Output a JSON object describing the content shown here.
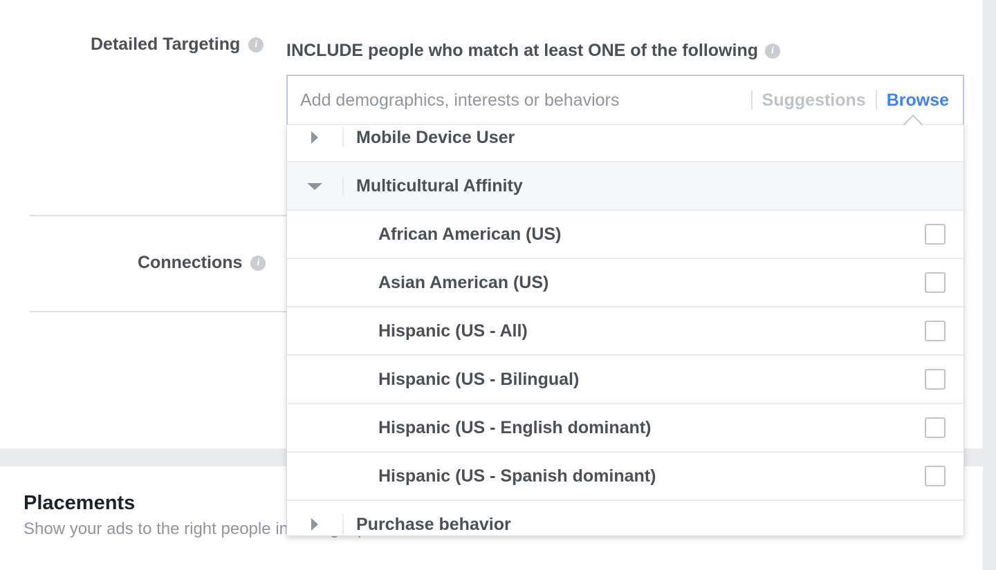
{
  "targeting": {
    "label": "Detailed Targeting",
    "include_text": "INCLUDE people who match at least ONE of the following",
    "search": {
      "placeholder": "Add demographics, interests or behaviors",
      "tabs": {
        "suggestions": "Suggestions",
        "browse": "Browse"
      },
      "active_tab": "Browse"
    }
  },
  "connections": {
    "label": "Connections"
  },
  "placements": {
    "title": "Placements",
    "subtitle": "Show your ads to the right people in the right places."
  },
  "browse_list": {
    "categories": [
      {
        "label": "Mobile Device User",
        "expanded": false
      },
      {
        "label": "Multicultural Affinity",
        "expanded": true,
        "items": [
          {
            "label": "African American (US)",
            "checked": false
          },
          {
            "label": "Asian American (US)",
            "checked": false
          },
          {
            "label": "Hispanic (US - All)",
            "checked": false
          },
          {
            "label": "Hispanic (US - Bilingual)",
            "checked": false
          },
          {
            "label": "Hispanic (US - English dominant)",
            "checked": false
          },
          {
            "label": "Hispanic (US - Spanish dominant)",
            "checked": false
          }
        ]
      },
      {
        "label": "Purchase behavior",
        "expanded": false
      }
    ]
  },
  "icons": {
    "info": "info-icon",
    "collapsed": "caret-right-icon",
    "expanded": "caret-down-icon"
  },
  "colors": {
    "accent": "#4080ff",
    "text": "#4b4f56",
    "muted": "#90949c",
    "border": "#bdc7d8",
    "band": "#e9ebee"
  }
}
